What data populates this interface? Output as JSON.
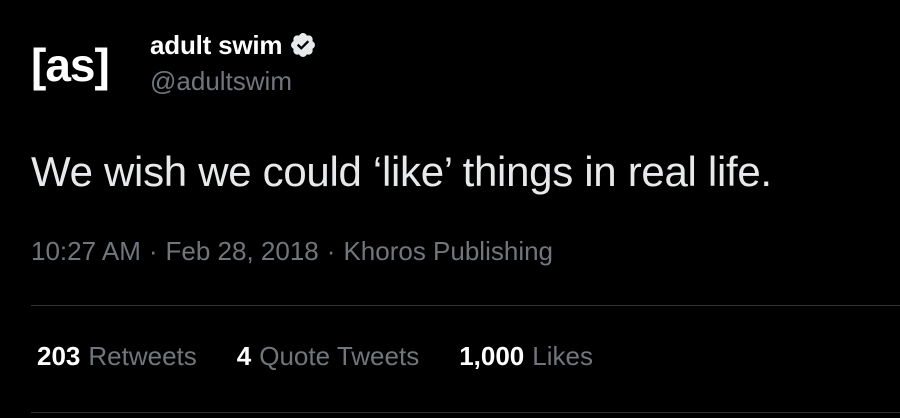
{
  "author": {
    "avatar_text": "[as]",
    "display_name": "adult swim",
    "handle": "@adultswim",
    "verified_icon": "verified-badge-icon"
  },
  "tweet": {
    "text": "We wish we could ‘like’ things in real life."
  },
  "meta": {
    "time": "10:27 AM",
    "date": "Feb 28, 2018",
    "source": "Khoros Publishing",
    "separator": "·"
  },
  "stats": {
    "retweets": {
      "count": "203",
      "label": "Retweets"
    },
    "quote_tweets": {
      "count": "4",
      "label": "Quote Tweets"
    },
    "likes": {
      "count": "1,000",
      "label": "Likes"
    }
  },
  "colors": {
    "background": "#000000",
    "primary_text": "#e7e9ea",
    "secondary_text": "#71767b",
    "divider": "#2f3336"
  }
}
